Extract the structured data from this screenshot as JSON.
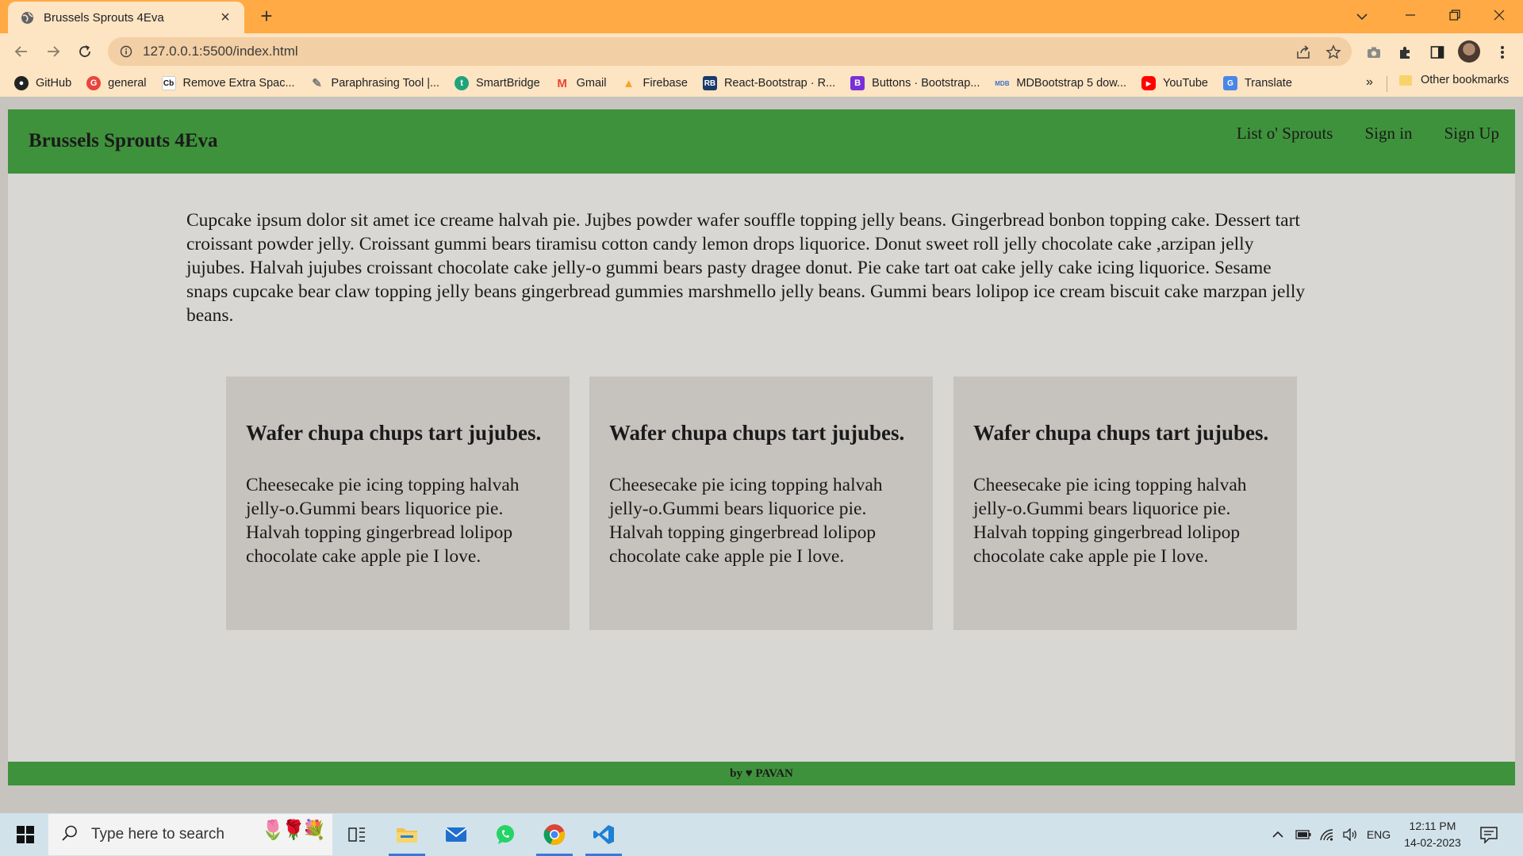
{
  "browser": {
    "tab_title": "Brussels Sprouts 4Eva",
    "url": "127.0.0.1:5500/index.html",
    "bookmarks": [
      {
        "label": "GitHub",
        "icon": "github-icon",
        "color": "#222222"
      },
      {
        "label": "general",
        "icon": "general-icon",
        "color": "#e8453c"
      },
      {
        "label": "Remove Extra Spac...",
        "icon": "cb-icon",
        "color": "#ffffff"
      },
      {
        "label": "Paraphrasing Tool |...",
        "icon": "pen-icon",
        "color": "#888888"
      },
      {
        "label": "SmartBridge",
        "icon": "smartbridge-icon",
        "color": "#1fa37a"
      },
      {
        "label": "Gmail",
        "icon": "gmail-icon",
        "color": "#ea4335"
      },
      {
        "label": "Firebase",
        "icon": "firebase-icon",
        "color": "#f5a623"
      },
      {
        "label": "React-Bootstrap · R...",
        "icon": "react-bootstrap-icon",
        "color": "#1b3a6b"
      },
      {
        "label": "Buttons · Bootstrap...",
        "icon": "bootstrap-icon",
        "color": "#7a2fd8"
      },
      {
        "label": "MDBootstrap 5 dow...",
        "icon": "mdb-icon",
        "color": "#3b71ca"
      },
      {
        "label": "YouTube",
        "icon": "youtube-icon",
        "color": "#ff0000"
      },
      {
        "label": "Translate",
        "icon": "translate-icon",
        "color": "#4a86e8"
      }
    ],
    "bookmarks_more": "»",
    "other_bookmarks": "Other bookmarks"
  },
  "site": {
    "brand": "Brussels Sprouts 4Eva",
    "nav": [
      "List o' Sprouts",
      "Sign in",
      "Sign Up"
    ],
    "intro": "Cupcake ipsum dolor sit amet ice creame halvah pie. Jujbes powder wafer souffle topping jelly beans. Gingerbread bonbon topping cake. Dessert tart croissant powder jelly. Croissant gummi bears tiramisu cotton candy lemon drops liquorice. Donut sweet roll jelly chocolate cake ,arzipan jelly jujubes. Halvah jujubes croissant chocolate cake jelly-o gummi bears pasty dragee donut. Pie cake tart oat cake jelly cake icing liquorice. Sesame snaps cupcake bear claw topping jelly beans gingerbread gummies marshmello jelly beans. Gummi bears lolipop ice cream biscuit cake marzpan jelly beans.",
    "cards": [
      {
        "title": "Wafer chupa chups tart jujubes.",
        "body": "Cheesecake pie icing topping halvah jelly-o.Gummi bears liquorice pie. Halvah topping gingerbread lolipop chocolate cake apple pie I love."
      },
      {
        "title": "Wafer chupa chups tart jujubes.",
        "body": "Cheesecake pie icing topping halvah jelly-o.Gummi bears liquorice pie. Halvah topping gingerbread lolipop chocolate cake apple pie I love."
      },
      {
        "title": "Wafer chupa chups tart jujubes.",
        "body": "Cheesecake pie icing topping halvah jelly-o.Gummi bears liquorice pie. Halvah topping gingerbread lolipop chocolate cake apple pie I love."
      }
    ],
    "footer": "by ♥ PAVAN",
    "colors": {
      "nav_green": "#3f923c",
      "page_bg": "#d8d7d4",
      "card_bg": "#c6c3bf"
    }
  },
  "taskbar": {
    "search_placeholder": "Type here to search",
    "language": "ENG",
    "time": "12:11 PM",
    "date": "14-02-2023"
  }
}
